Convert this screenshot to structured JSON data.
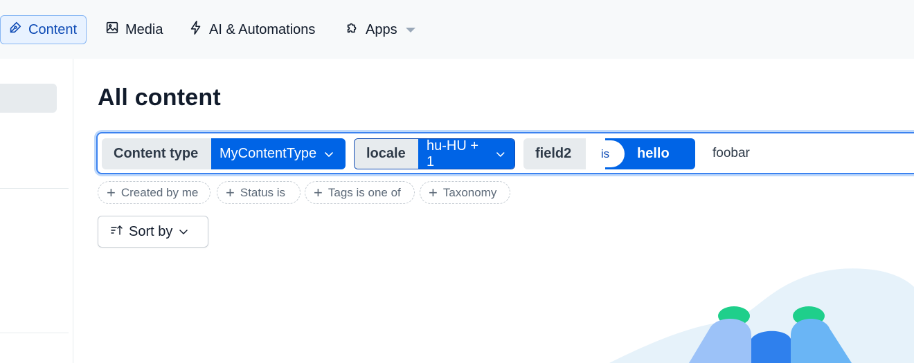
{
  "nav": {
    "content_label": "Content",
    "media_label": "Media",
    "ai_label": "AI & Automations",
    "apps_label": "Apps"
  },
  "main": {
    "title": "All content",
    "search": {
      "filters": [
        {
          "key": "Content type",
          "value": "MyContentType"
        },
        {
          "key": "locale",
          "value": "hu-HU + 1"
        },
        {
          "key": "field2",
          "operator": "is",
          "value": "hello"
        }
      ],
      "text": "foobar"
    },
    "suggestions": [
      "Created by me",
      "Status is",
      "Tags is one of",
      "Taxonomy"
    ],
    "sort_label": "Sort by"
  },
  "colors": {
    "accent": "#0064e6",
    "nav_bg": "#f7f9fa",
    "pill_key_bg": "#e7ebee"
  }
}
